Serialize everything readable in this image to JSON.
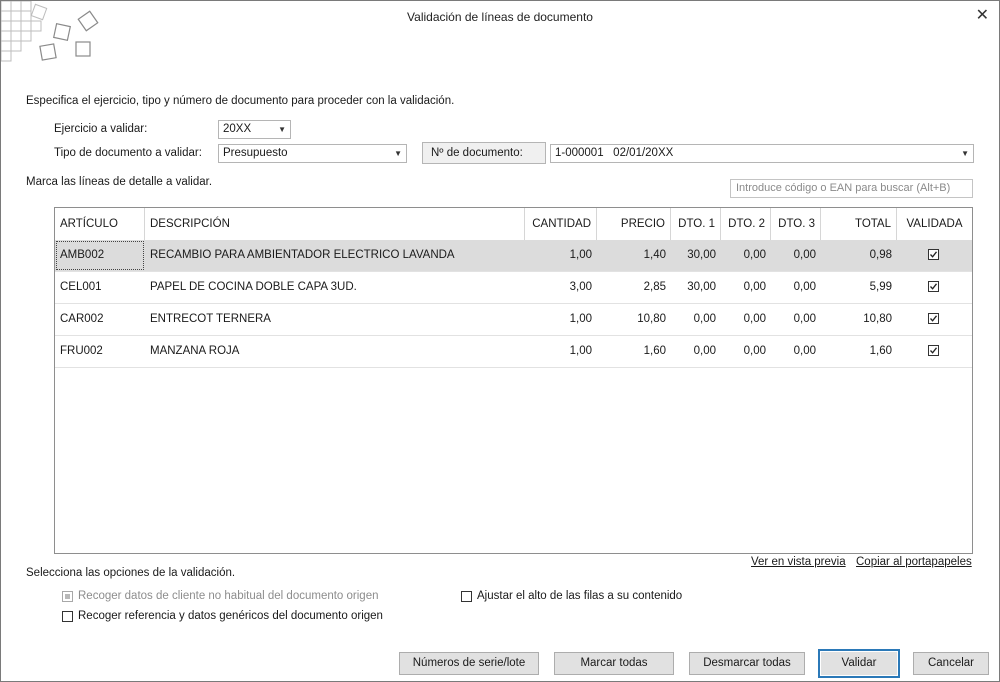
{
  "window": {
    "title": "Validación de líneas de documento",
    "close_glyph": "✕"
  },
  "intro_text": "Especifica el ejercicio, tipo y número de documento para proceder con la validación.",
  "ejercicio": {
    "label": "Ejercicio a validar:",
    "value": "20XX"
  },
  "tipo_documento": {
    "label": "Tipo de documento a validar:",
    "value": "Presupuesto"
  },
  "numero_documento": {
    "label": "Nº de documento:",
    "value": "1-000001   02/01/20XX"
  },
  "lines_label": "Marca las líneas de detalle a validar.",
  "search": {
    "placeholder": "Introduce código o EAN para buscar (Alt+B)"
  },
  "table": {
    "columns": [
      "ARTÍCULO",
      "DESCRIPCIÓN",
      "CANTIDAD",
      "PRECIO",
      "DTO. 1",
      "DTO. 2",
      "DTO. 3",
      "TOTAL",
      "VALIDADA"
    ],
    "rows": [
      {
        "articulo": "AMB002",
        "descripcion": "RECAMBIO PARA AMBIENTADOR ELECTRICO LAVANDA",
        "cantidad": "1,00",
        "precio": "1,40",
        "dto1": "30,00",
        "dto2": "0,00",
        "dto3": "0,00",
        "total": "0,98",
        "validada": true
      },
      {
        "articulo": "CEL001",
        "descripcion": "PAPEL DE COCINA DOBLE CAPA 3UD.",
        "cantidad": "3,00",
        "precio": "2,85",
        "dto1": "30,00",
        "dto2": "0,00",
        "dto3": "0,00",
        "total": "5,99",
        "validada": true
      },
      {
        "articulo": "CAR002",
        "descripcion": "ENTRECOT TERNERA",
        "cantidad": "1,00",
        "precio": "10,80",
        "dto1": "0,00",
        "dto2": "0,00",
        "dto3": "0,00",
        "total": "10,80",
        "validada": true
      },
      {
        "articulo": "FRU002",
        "descripcion": "MANZANA ROJA",
        "cantidad": "1,00",
        "precio": "1,60",
        "dto1": "0,00",
        "dto2": "0,00",
        "dto3": "0,00",
        "total": "1,60",
        "validada": true
      }
    ]
  },
  "links": {
    "preview": "Ver en vista previa",
    "copy": "Copiar al portapapeles"
  },
  "options": {
    "label": "Selecciona las opciones de la validación.",
    "recoger_cliente": "Recoger datos de cliente no habitual del documento origen",
    "recoger_referencia": "Recoger referencia y datos genéricos del documento origen",
    "ajustar_alto": "Ajustar el alto de las filas a su contenido"
  },
  "buttons": {
    "series": "Números de serie/lote",
    "marcar": "Marcar todas",
    "desmarcar": "Desmarcar todas",
    "validar": "Validar",
    "cancelar": "Cancelar"
  },
  "colors": {
    "accent": "#2b79b8",
    "selected_row": "#dcdcdc",
    "button_face": "#e1e1e1"
  },
  "icons": {
    "combo_arrow": "▼"
  }
}
